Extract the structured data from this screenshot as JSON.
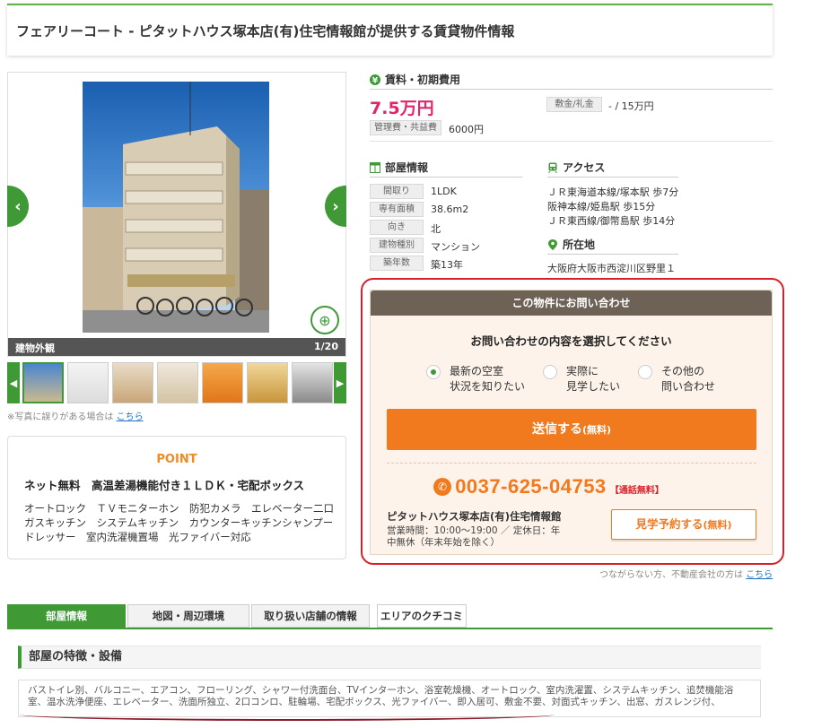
{
  "page_title": "フェアリーコート - ピタットハウス塚本店(有)住宅情報館が提供する賃貸物件情報",
  "photo": {
    "caption": "建物外観",
    "counter": "1/20",
    "prev": "‹",
    "next": "›",
    "zoom": "⊕",
    "thumb_prev": "◀",
    "thumb_next": "▶"
  },
  "photo_note": {
    "text": "※写真に誤りがある場合は",
    "link": "こちら"
  },
  "point": {
    "heading": "POINT",
    "lead": "ネット無料　高温差湯機能付き１ＬＤＫ・宅配ボックス",
    "body": "オートロック　ＴＶモニターホン　防犯カメラ　エレベーター二口ガスキッチン　システムキッチン　カウンターキッチンシャンプードレッサー　室内洗濯機置場　光ファイバー対応"
  },
  "rent": {
    "heading": "賃料・初期費用",
    "price": "7.5万円",
    "deposit_label": "敷金/礼金",
    "deposit_value": "- / 15万円",
    "mgmt_label": "管理費・共益費",
    "mgmt_value": "6000円"
  },
  "room": {
    "heading": "部屋情報",
    "rows": [
      {
        "label": "間取り",
        "value": "1LDK"
      },
      {
        "label": "専有面積",
        "value": "38.6m2"
      },
      {
        "label": "向き",
        "value": "北"
      },
      {
        "label": "建物種別",
        "value": "マンション"
      },
      {
        "label": "築年数",
        "value": "築13年"
      }
    ]
  },
  "access": {
    "heading": "アクセス",
    "lines": [
      "ＪＲ東海道本線/塚本駅 歩7分",
      "阪神本線/姫島駅 歩15分",
      "ＪＲ東西線/御幣島駅 歩14分"
    ]
  },
  "location": {
    "heading": "所在地",
    "address": "大阪府大阪市西淀川区野里１"
  },
  "inquiry": {
    "header": "この物件にお問い合わせ",
    "question": "お問い合わせの内容を選択してください",
    "options": [
      {
        "line1": "最新の空室",
        "line2": "状況を知りたい"
      },
      {
        "line1": "実際に",
        "line2": "見学したい"
      },
      {
        "line1": "その他の",
        "line2": "問い合わせ"
      }
    ],
    "send_label": "送信する",
    "send_free": "(無料)",
    "tel_icon": "✆",
    "tel": "0037-625-04753",
    "tel_free": "【通話無料】",
    "shop": "ピタットハウス塚本店(有)住宅情報館",
    "hours": "営業時間：10:00～19:00 ／ 定休日：年中無休（年末年始を除く）",
    "visit_label": "見学予約する",
    "visit_free": "(無料)"
  },
  "not_connected": {
    "text": "つながらない方、不動産会社の方は",
    "link": "こちら"
  },
  "tabs": [
    "部屋情報",
    "地図・周辺環境",
    "取り扱い店舗の情報",
    "エリアのクチコミ"
  ],
  "features": {
    "heading": "部屋の特徴・設備",
    "text": "バストイレ別、バルコニー、エアコン、フローリング、シャワー付洗面台、TVインターホン、浴室乾燥機、オートロック、室内洗濯置、システムキッチン、追焚機能浴室、温水洗浄便座、エレベーター、洗面所独立、2口コンロ、駐輪場、宅配ボックス、光ファイバー、即入居可、敷金不要、対面式キッチン、出窓、ガスレンジ付、"
  },
  "colors": {
    "green": "#3f9a36",
    "orange": "#f27a1e",
    "pink": "#e0266a",
    "red_highlight": "#d9202a"
  }
}
